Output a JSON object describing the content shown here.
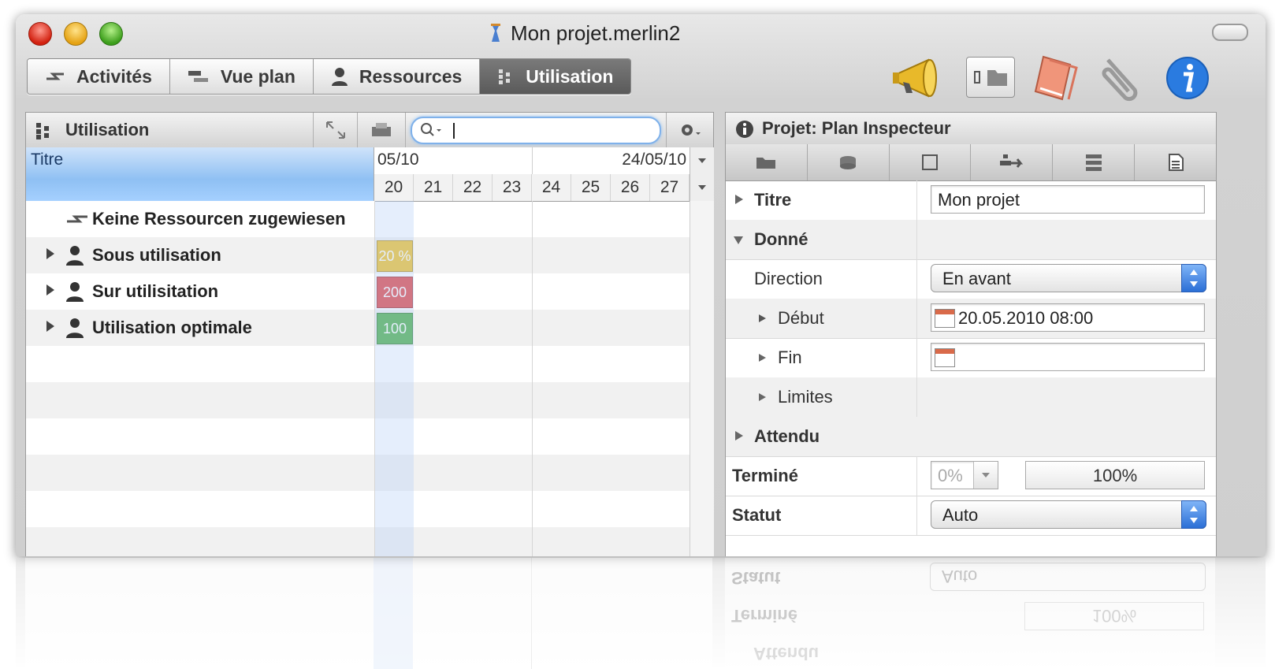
{
  "window": {
    "title": "Mon projet.merlin2"
  },
  "tabs": [
    {
      "label": "Activités",
      "icon": "activities-icon",
      "active": false
    },
    {
      "label": "Vue plan",
      "icon": "gantt-icon",
      "active": false
    },
    {
      "label": "Ressources",
      "icon": "person-icon",
      "active": false
    },
    {
      "label": "Utilisation",
      "icon": "utilisation-icon",
      "active": true
    }
  ],
  "toolbar_icons": [
    "megaphone-icon",
    "view-toggle-icon",
    "notes-book-icon",
    "paperclip-icon",
    "info-icon"
  ],
  "left_panel": {
    "title": "Utilisation",
    "search": {
      "value": "",
      "placeholder": ""
    },
    "columns": {
      "title": "Titre",
      "date_left": "05/10",
      "date_right": "24/05/10",
      "days": [
        "20",
        "21",
        "22",
        "23",
        "24",
        "25",
        "26",
        "27"
      ]
    },
    "rows": [
      {
        "label": "Keine Ressourcen zugewiesen",
        "badge": "",
        "badge_color": ""
      },
      {
        "label": "Sous utilisation",
        "badge": "20 %",
        "badge_color": "#f0c22c"
      },
      {
        "label": "Sur utilisitation",
        "badge": "200",
        "badge_color": "#e04848"
      },
      {
        "label": "Utilisation optimale",
        "badge": "100",
        "badge_color": "#4fb04a"
      }
    ]
  },
  "inspector": {
    "title": "Projet: Plan Inspecteur",
    "titre_label": "Titre",
    "titre_value": "Mon projet",
    "donne_label": "Donné",
    "direction_label": "Direction",
    "direction_value": "En avant",
    "debut_label": "Début",
    "debut_value": "20.05.2010 08:00",
    "fin_label": "Fin",
    "fin_value": "",
    "limites_label": "Limites",
    "attendu_label": "Attendu",
    "termine_label": "Terminé",
    "termine_value": "0%",
    "termine_button": "100%",
    "statut_label": "Statut",
    "statut_value": "Auto"
  }
}
